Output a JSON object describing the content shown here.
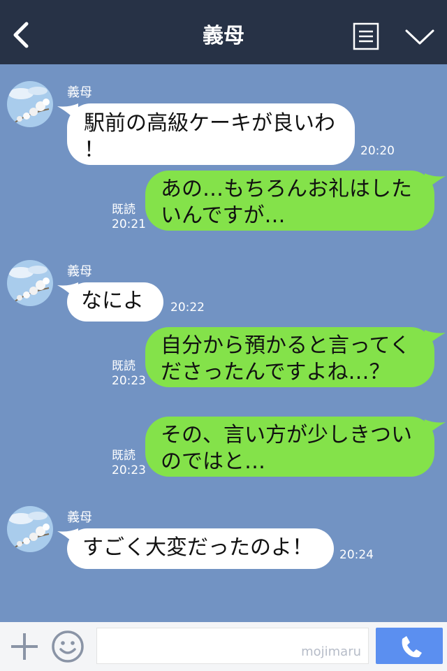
{
  "header": {
    "title": "義母"
  },
  "messages": [
    {
      "sender": "義母",
      "lines": [
        "駅前の高級ケーキが良いわ",
        "！"
      ],
      "time": "20:20"
    },
    {
      "lines": [
        "あの…もちろんお礼はした",
        "いんですが…"
      ],
      "read": "既読",
      "time": "20:21"
    },
    {
      "sender": "義母",
      "lines": [
        "なによ"
      ],
      "time": "20:22"
    },
    {
      "lines": [
        "自分から預かると言ってく",
        "ださったんですよね…？"
      ],
      "read": "既読",
      "time": "20:23"
    },
    {
      "lines": [
        "その、言い方が少しきつい",
        "のではと…"
      ],
      "read": "既読",
      "time": "20:23"
    },
    {
      "sender": "義母",
      "lines": [
        "すごく大変だったのよ！"
      ],
      "time": "20:24"
    }
  ],
  "footer": {
    "input_value": "",
    "watermark": "mojimaru"
  },
  "colors": {
    "header": "#273246",
    "chat_bg": "#7293c3",
    "sent_bubble": "#84e24a",
    "received_bubble": "#ffffff",
    "call_button": "#5b8ff0"
  },
  "icons": {
    "back": "chevron-left-icon",
    "menu": "note-list-icon",
    "collapse": "chevron-down-icon",
    "add": "plus-icon",
    "emoji": "smiley-icon",
    "call": "phone-icon"
  }
}
